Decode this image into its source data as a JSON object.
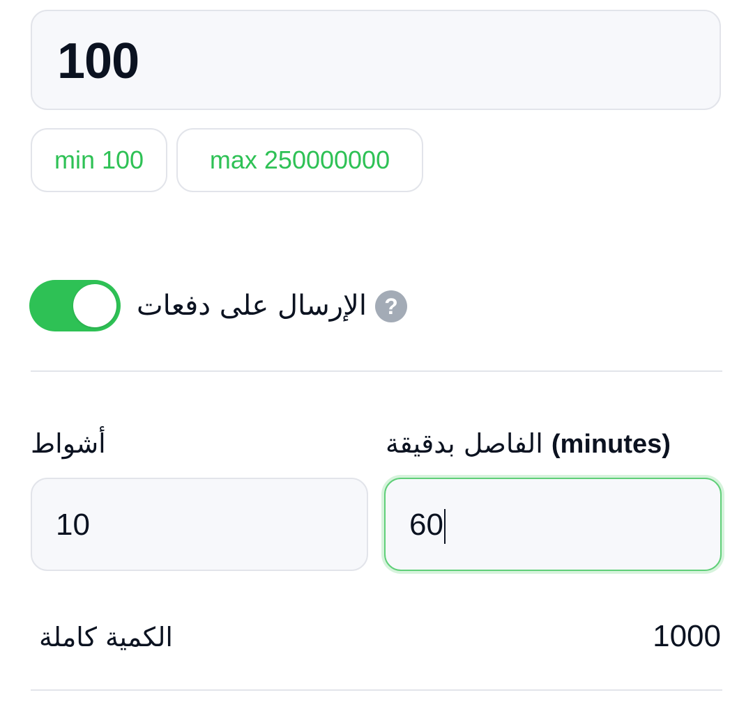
{
  "quantity": {
    "value": "100"
  },
  "limits": {
    "min_label": "min 100",
    "max_label": "max 250000000"
  },
  "batch": {
    "toggle_on": true,
    "label": "الإرسال على دفعات",
    "help_icon": "question-mark",
    "toggle_color": "#2ec155"
  },
  "runs": {
    "label": "أشواط",
    "value": "10"
  },
  "interval": {
    "label_en": "(minutes)",
    "label_ar": "الفاصل بدقيقة",
    "value": "60"
  },
  "total": {
    "label": "الكمية كاملة",
    "value": "1000"
  },
  "colors": {
    "accent": "#2ec155",
    "focus_border": "#5fcf78"
  }
}
